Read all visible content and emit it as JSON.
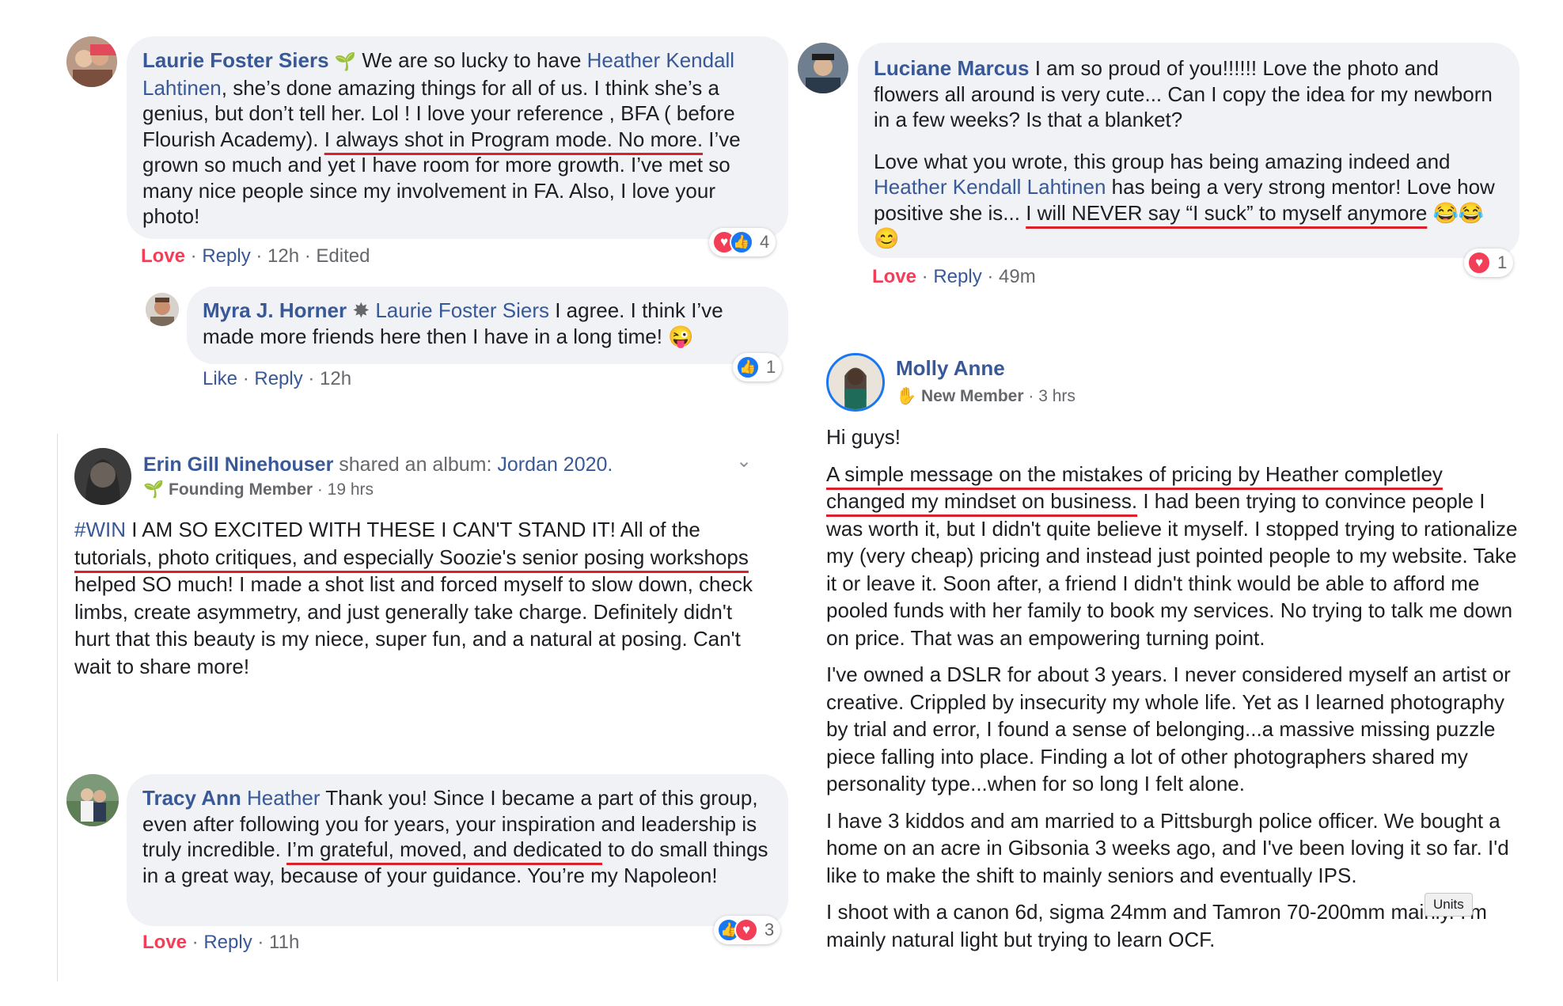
{
  "comments": {
    "laurie": {
      "name": "Laurie Foster Siers",
      "mention": "Heather Kendall Lahtinen",
      "text_a": ", she’s done amazing things for all of us. I think she’s a genius, but don’t tell her. Lol ! I love your reference , BFA ( before Flourish Academy). ",
      "text_hl": "I always shot in Program mode. No more.",
      "text_b": " I’ve grown so much and yet I have room for more growth. I’ve met so many nice people since my involvement in FA. Also, I love your photo!",
      "text_intro": " We are so lucky to have ",
      "reaction_label": "Love",
      "reply_label": "Reply",
      "time": "12h",
      "edited": "Edited",
      "reaction_count": "4"
    },
    "myra": {
      "name": "Myra J. Horner",
      "mention": "Laurie Foster Siers",
      "text": " I agree. I think I’ve made more friends here then I have in a long time! 😜",
      "like_label": "Like",
      "reply_label": "Reply",
      "time": "12h",
      "reaction_count": "1"
    },
    "luciane": {
      "name": "Luciane Marcus",
      "text_1": " I am so proud of you!!!!!! Love the photo and flowers all around is very cute... Can I copy the idea for my newborn in a few weeks? Is that a blanket?",
      "text_2a": "Love what you wrote, this group has being amazing indeed and ",
      "mention": "Heather Kendall Lahtinen",
      "text_2b": " has being a very strong mentor! Love how positive she is... ",
      "text_hl": "I will NEVER say “I suck” to myself anymore",
      "emojis": "😂😂😊",
      "reaction_label": "Love",
      "reply_label": "Reply",
      "time": "49m",
      "reaction_count": "1"
    },
    "tracy": {
      "name": "Tracy Ann",
      "mention": "Heather",
      "text_a": " Thank you! Since I became a part of this group, even after following you for years, your inspiration and leadership is truly incredible. ",
      "text_hl": "I’m grateful, moved, and dedicated",
      "text_b": " to do small things in a great way, because of your guidance. You’re my Napoleon!",
      "reaction_label": "Love",
      "reply_label": "Reply",
      "time": "11h",
      "reaction_count": "3"
    }
  },
  "posts": {
    "erin": {
      "name": "Erin Gill Ninehouser",
      "shared": " shared an album: ",
      "album": "Jordan 2020.",
      "badge": "Founding Member",
      "time": "19 hrs",
      "hashtag": "#WIN",
      "text_a": " I AM SO EXCITED WITH THESE I CAN'T STAND IT! All of the ",
      "text_hl": "tutorials, photo critiques, and especially Soozie's senior posing workshops",
      "text_b": " helped SO much! I made a shot list and forced myself to slow down, check limbs, create asymmetry, and just generally take charge. Definitely didn't hurt that this beauty is my niece, super fun, and a natural at posing. Can't wait to share more!"
    },
    "molly": {
      "name": "Molly Anne",
      "badge": "New Member",
      "time": "3 hrs",
      "greeting": "Hi guys!",
      "p1_hl": "A simple message on the mistakes of pricing by Heather completley changed my mindset on business.",
      "p1_rest": " I had been trying to convince people I was worth it, but I didn't quite believe it myself. I stopped trying to rationalize my (very cheap) pricing and instead just pointed people to my website. Take it or leave it. Soon after, a friend I didn't think would be able to afford me pooled funds with her family to book my services. No trying to talk me down on price. That was an empowering turning point.",
      "p2": "I've owned a DSLR for about 3 years. I never considered myself an artist or creative. Crippled by insecurity my whole life. Yet as I learned photography by trial and error, I found a sense of belonging...a massive missing puzzle piece falling into place. Finding a lot of other photographers shared my personality type...when for so long I felt alone.",
      "p3": "I have 3 kiddos and am married to a Pittsburgh police officer. We bought a home on an acre in Gibsonia 3 weeks ago, and I've been loving it so far. I'd like to make the shift to mainly seniors and eventually IPS.",
      "p4": "I shoot with a canon 6d, sigma 24mm and Tamron 70-200mm mainly. I'm mainly natural light but trying to learn OCF.",
      "tooltip": "Units"
    }
  },
  "colors": {
    "link": "#385898",
    "love": "#f33e58",
    "like": "#1877f2",
    "underline": "#d9202b",
    "bubble": "#f0f2f5"
  }
}
